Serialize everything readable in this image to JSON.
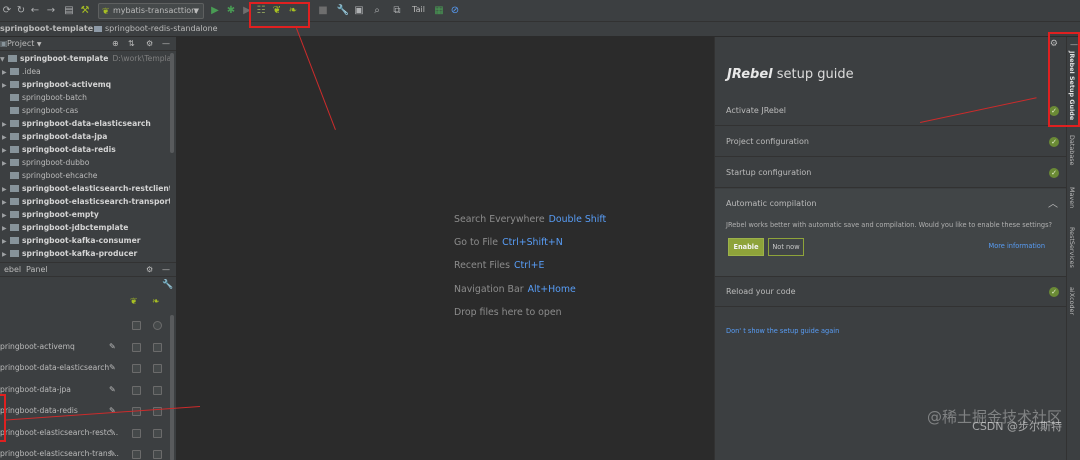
{
  "toolbar": {
    "run_config": "mybatis-transacttion",
    "tail_label": "Tail"
  },
  "breadcrumb": {
    "project": "springboot-template",
    "module": "springboot-redis-standalone"
  },
  "project_panel": {
    "title": "Project",
    "tree": [
      {
        "label": "springboot-template",
        "path": "D:\\work\\Template\\sp",
        "bold": true,
        "expanded": true
      },
      {
        "label": ".idea",
        "bold": false,
        "arrow": true
      },
      {
        "label": "springboot-activemq",
        "bold": true,
        "arrow": true
      },
      {
        "label": "springboot-batch",
        "bold": false,
        "arrow": false
      },
      {
        "label": "springboot-cas",
        "bold": false,
        "arrow": false
      },
      {
        "label": "springboot-data-elasticsearch",
        "bold": true,
        "arrow": true
      },
      {
        "label": "springboot-data-jpa",
        "bold": true,
        "arrow": true
      },
      {
        "label": "springboot-data-redis",
        "bold": true,
        "arrow": true
      },
      {
        "label": "springboot-dubbo",
        "bold": false,
        "arrow": true
      },
      {
        "label": "springboot-ehcache",
        "bold": false,
        "arrow": false
      },
      {
        "label": "springboot-elasticsearch-restclient",
        "bold": true,
        "arrow": true
      },
      {
        "label": "springboot-elasticsearch-transportclie",
        "bold": true,
        "arrow": true
      },
      {
        "label": "springboot-empty",
        "bold": true,
        "arrow": true
      },
      {
        "label": "springboot-jdbctemplate",
        "bold": true,
        "arrow": true
      },
      {
        "label": "springboot-kafka-consumer",
        "bold": true,
        "arrow": true
      },
      {
        "label": "springboot-kafka-producer",
        "bold": true,
        "arrow": true
      }
    ]
  },
  "jrebel_panel": {
    "tab_1": "ebel",
    "tab_2": "Panel",
    "rows": [
      {
        "label": ""
      },
      {
        "label": "pringboot-activemq"
      },
      {
        "label": "pringboot-data-elasticsearch"
      },
      {
        "label": "pringboot-data-jpa"
      },
      {
        "label": "pringboot-data-redis"
      },
      {
        "label": "pringboot-elasticsearch-restc..."
      },
      {
        "label": "pringboot-elasticsearch-trans..."
      }
    ]
  },
  "editor": {
    "hints": [
      {
        "text": "Search Everywhere",
        "key": "Double Shift"
      },
      {
        "text": "Go to File",
        "key": "Ctrl+Shift+N"
      },
      {
        "text": "Recent Files",
        "key": "Ctrl+E"
      },
      {
        "text": "Navigation Bar",
        "key": "Alt+Home"
      },
      {
        "text": "Drop files here to open",
        "key": ""
      }
    ]
  },
  "setup_guide": {
    "brand": "JRebel",
    "title": "setup guide",
    "steps": [
      {
        "label": "Activate JRebel",
        "done": true
      },
      {
        "label": "Project configuration",
        "done": true
      },
      {
        "label": "Startup configuration",
        "done": true
      }
    ],
    "auto_compile": {
      "label": "Automatic compilation",
      "description": "JRebel works better with automatic save and compilation. Would you like to enable these settings?",
      "enable": "Enable",
      "not_now": "Not now",
      "more_info": "More information"
    },
    "reload": {
      "label": "Reload your code",
      "done": true
    },
    "dont_show": "Don'  t show the setup guide again"
  },
  "right_strip": {
    "tabs": [
      "JRebel Setup Guide",
      "Database",
      "Maven",
      "RestServices",
      "aiXcoder"
    ]
  },
  "watermarks": {
    "line_1": "CSDN @步尔斯特",
    "line_2": "@稀土掘金技术社区"
  },
  "colors": {
    "accent_blue": "#589df6",
    "jrebel_green": "#8ea33a",
    "highlight_red": "#e02020"
  }
}
